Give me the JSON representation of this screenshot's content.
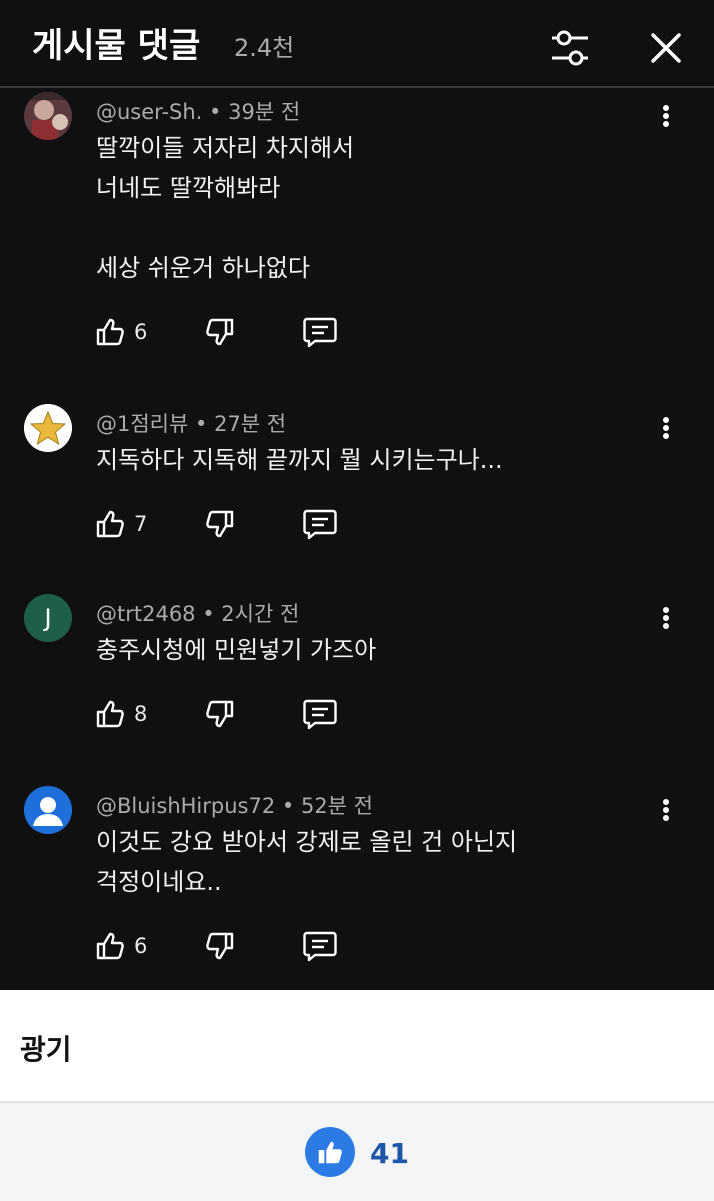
{
  "header": {
    "title": "게시물 댓글",
    "count": "2.4천",
    "filter_icon": "sliders-icon",
    "close_icon": "close-icon"
  },
  "comments": [
    {
      "author": "@user-Sh.",
      "time": "39분 전",
      "lines": [
        "딸깍이들 저자리 차지해서",
        "너네도 딸깍해봐라",
        "",
        "세상 쉬운거 하나없다"
      ],
      "likes": "6",
      "avatar": "photo"
    },
    {
      "author": "@1점리뷰",
      "time": "27분 전",
      "lines": [
        "지독하다 지독해 끝까지 뭘 시키는구나..."
      ],
      "likes": "7",
      "avatar": "star"
    },
    {
      "author": "@trt2468",
      "time": "2시간 전",
      "lines": [
        "충주시청에 민원넣기 가즈아"
      ],
      "likes": "8",
      "avatar": "letter",
      "avatar_letter": "J"
    },
    {
      "author": "@BluishHirpus72",
      "time": "52분 전",
      "lines": [
        "이것도 강요 받아서 강제로 올린 건 아닌지",
        "걱정이네요.."
      ],
      "likes": "6",
      "avatar": "default-user"
    }
  ],
  "ad": {
    "label": "광기"
  },
  "bottom": {
    "like_count": "41"
  },
  "colors": {
    "panel_bg": "#101010",
    "like_blue": "#2c7be5",
    "avatar_green": "#1f5f4a",
    "avatar_blue": "#1e6fd9"
  }
}
